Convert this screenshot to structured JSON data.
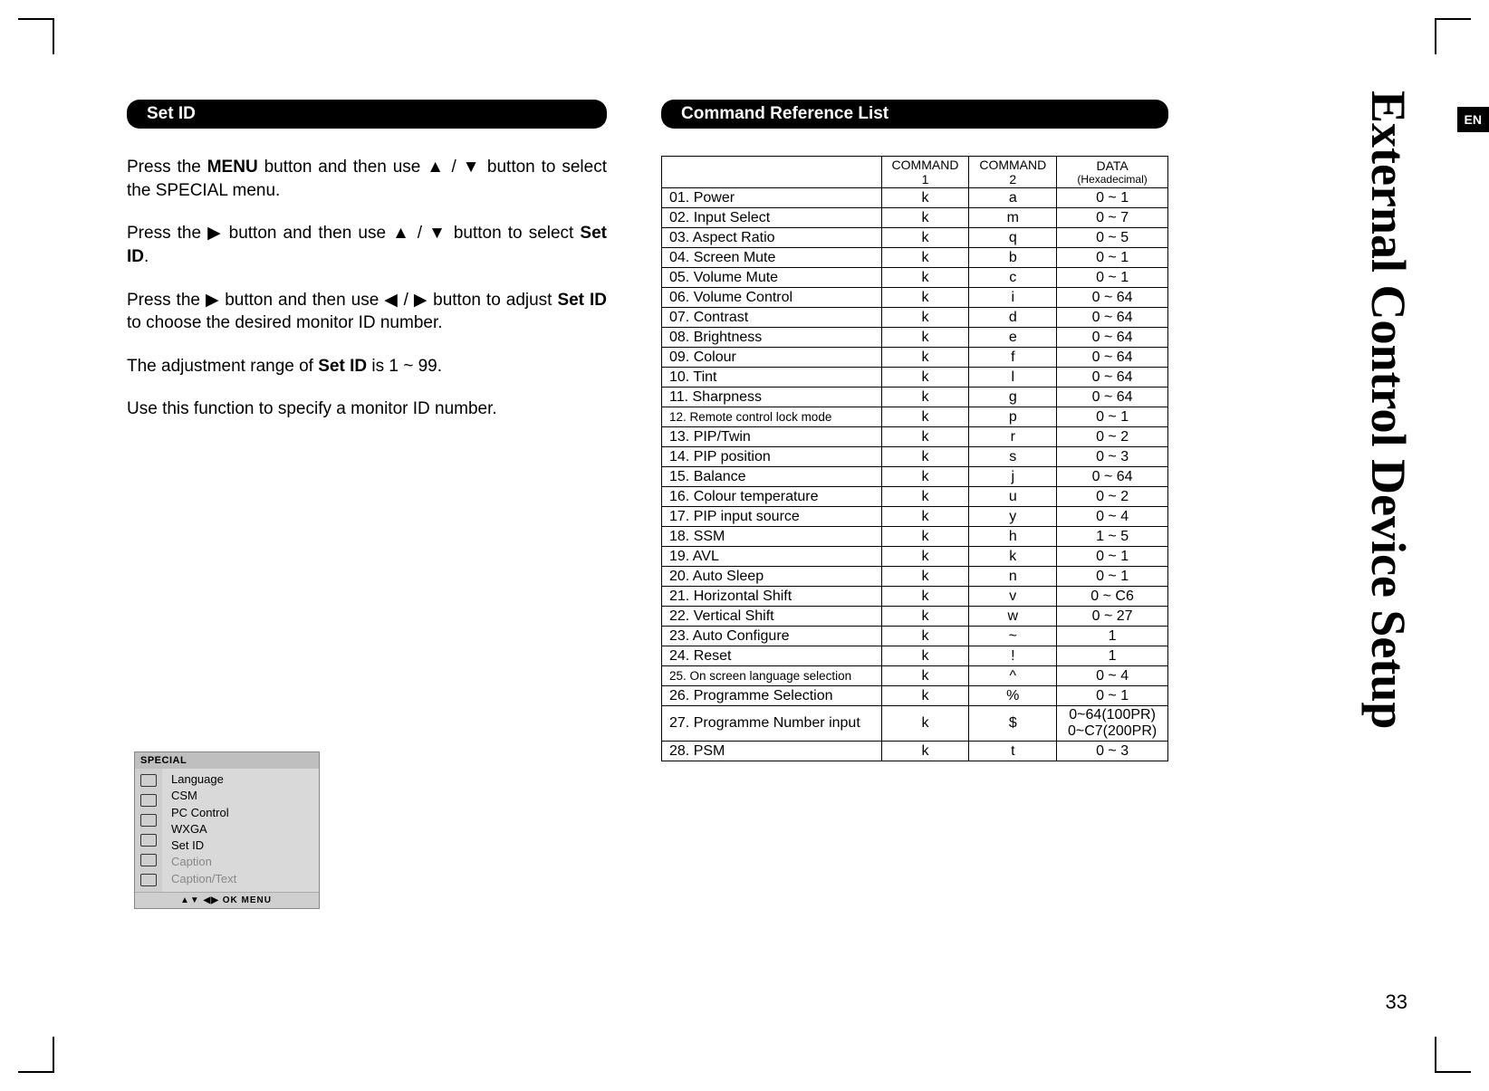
{
  "page": {
    "side_title": "External Control Device Setup",
    "lang": "EN",
    "number": "33"
  },
  "left": {
    "heading": "Set ID",
    "p1_a": "Press the ",
    "p1_b": "MENU",
    "p1_c": " button and then use ▲ / ▼ button to select the SPECIAL menu.",
    "p2_a": "Press the ▶ button and then use ▲ / ▼ button to select ",
    "p2_b": "Set ID",
    "p2_c": ".",
    "p3_a": "Press the ▶ button and then use ◀ / ▶ button to adjust ",
    "p3_b": "Set ID",
    "p3_c": " to choose the desired monitor ID number.",
    "p4_a": "The adjustment range of ",
    "p4_b": "Set ID",
    "p4_c": " is 1 ~ 99.",
    "p5": "Use this function to specify a monitor ID number."
  },
  "osd": {
    "title": "SPECIAL",
    "items": [
      "Language",
      "CSM",
      "PC Control",
      "WXGA",
      "Set ID",
      "Caption",
      "Caption/Text"
    ],
    "footer": "▲▼   ◀▶   OK   MENU"
  },
  "right": {
    "heading": "Command Reference List",
    "headers": {
      "blank": "",
      "c1a": "COMMAND",
      "c1b": "1",
      "c2a": "COMMAND",
      "c2b": "2",
      "d1": "DATA",
      "d2": "(Hexadecimal)"
    },
    "rows": [
      {
        "name": "01. Power",
        "c1": "k",
        "c2": "a",
        "data": "0 ~ 1"
      },
      {
        "name": "02. Input Select",
        "c1": "k",
        "c2": "m",
        "data": "0 ~ 7"
      },
      {
        "name": "03. Aspect Ratio",
        "c1": "k",
        "c2": "q",
        "data": "0 ~ 5"
      },
      {
        "name": "04. Screen Mute",
        "c1": "k",
        "c2": "b",
        "data": "0 ~ 1"
      },
      {
        "name": "05. Volume Mute",
        "c1": "k",
        "c2": "c",
        "data": "0 ~ 1"
      },
      {
        "name": "06. Volume Control",
        "c1": "k",
        "c2": "i",
        "data": "0 ~ 64"
      },
      {
        "name": "07. Contrast",
        "c1": "k",
        "c2": "d",
        "data": "0 ~ 64"
      },
      {
        "name": "08. Brightness",
        "c1": "k",
        "c2": "e",
        "data": "0 ~ 64"
      },
      {
        "name": "09. Colour",
        "c1": "k",
        "c2": "f",
        "data": "0 ~ 64"
      },
      {
        "name": "10. Tint",
        "c1": "k",
        "c2": "l",
        "data": "0 ~ 64"
      },
      {
        "name": "11. Sharpness",
        "c1": "k",
        "c2": "g",
        "data": "0 ~ 64"
      },
      {
        "name": "12. Remote control lock mode",
        "c1": "k",
        "c2": "p",
        "data": "0 ~ 1",
        "small": true
      },
      {
        "name": "13. PIP/Twin",
        "c1": "k",
        "c2": "r",
        "data": "0 ~ 2"
      },
      {
        "name": "14. PIP position",
        "c1": "k",
        "c2": "s",
        "data": "0 ~ 3"
      },
      {
        "name": "15. Balance",
        "c1": "k",
        "c2": "j",
        "data": "0 ~ 64"
      },
      {
        "name": "16. Colour temperature",
        "c1": "k",
        "c2": "u",
        "data": "0 ~ 2"
      },
      {
        "name": "17. PIP input source",
        "c1": "k",
        "c2": "y",
        "data": "0 ~ 4"
      },
      {
        "name": "18. SSM",
        "c1": "k",
        "c2": "h",
        "data": "1 ~ 5"
      },
      {
        "name": "19. AVL",
        "c1": "k",
        "c2": "k",
        "data": "0 ~ 1"
      },
      {
        "name": "20. Auto Sleep",
        "c1": "k",
        "c2": "n",
        "data": "0 ~ 1"
      },
      {
        "name": "21. Horizontal Shift",
        "c1": "k",
        "c2": "v",
        "data": "0 ~ C6"
      },
      {
        "name": "22. Vertical Shift",
        "c1": "k",
        "c2": "w",
        "data": "0 ~ 27"
      },
      {
        "name": "23. Auto Configure",
        "c1": "k",
        "c2": "~",
        "data": "1"
      },
      {
        "name": "24. Reset",
        "c1": "k",
        "c2": "!",
        "data": "1"
      },
      {
        "name": "25. On screen language selection",
        "c1": "k",
        "c2": "^",
        "data": "0 ~ 4",
        "small": true
      },
      {
        "name": "26. Programme Selection",
        "c1": "k",
        "c2": "%",
        "data": "0 ~ 1"
      },
      {
        "name": "27. Programme Number input",
        "c1": "k",
        "c2": "$",
        "data": "0~64(100PR)\n0~C7(200PR)"
      },
      {
        "name": "28. PSM",
        "c1": "k",
        "c2": "t",
        "data": "0 ~ 3"
      }
    ]
  }
}
